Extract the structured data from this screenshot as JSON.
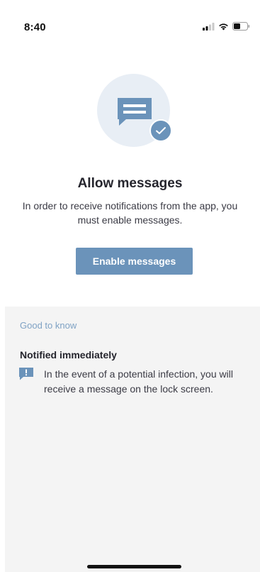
{
  "status_bar": {
    "time": "8:40",
    "icons": [
      "signal-icon",
      "wifi-icon",
      "battery-icon"
    ]
  },
  "hero": {
    "icon": "message-bubble-icon",
    "badge_icon": "checkmark-icon"
  },
  "main": {
    "title": "Allow messages",
    "description": "In order to receive notifications from the app, you must enable messages.",
    "button_label": "Enable messages"
  },
  "info": {
    "section_label": "Good to know",
    "items": [
      {
        "icon": "alert-message-icon",
        "heading": "Notified immediately",
        "text": "In the event of a potential infection, you will receive a message on the lock screen."
      }
    ]
  },
  "colors": {
    "accent": "#6b93ba",
    "hero_background": "#e8eef5",
    "panel_background": "#f4f4f4",
    "section_label": "#7fa2c4"
  }
}
